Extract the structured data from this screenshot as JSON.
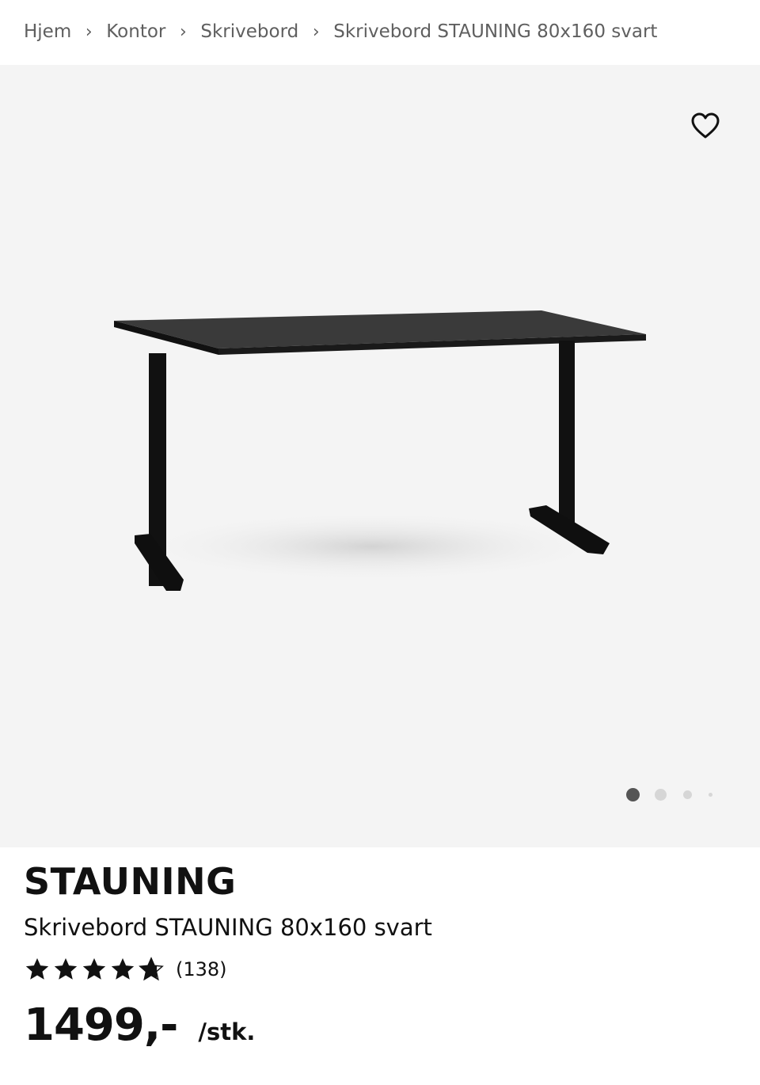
{
  "breadcrumb": {
    "items": [
      {
        "label": "Hjem"
      },
      {
        "label": "Kontor"
      },
      {
        "label": "Skrivebord"
      },
      {
        "label": "Skrivebord STAUNING 80x160 svart"
      }
    ],
    "separator": "›"
  },
  "gallery": {
    "favorite_icon": "heart-outline-icon",
    "image_count": 4,
    "active_index": 0
  },
  "product": {
    "brand": "STAUNING",
    "name": "Skrivebord STAUNING 80x160 svart",
    "rating": 4.7,
    "rating_max": 5,
    "review_count": "(138)",
    "price": "1499,-",
    "unit": "/stk."
  },
  "colors": {
    "gallery_bg": "#f4f4f4",
    "text": "#111111",
    "breadcrumb_text": "#5f5f5f",
    "dot_active": "#555555",
    "dot_inactive": "#d6d6d6"
  }
}
